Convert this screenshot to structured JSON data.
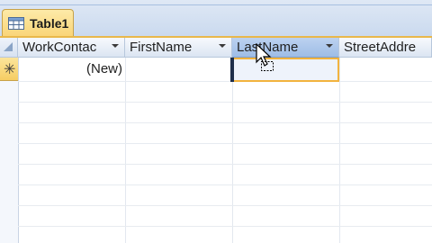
{
  "table_tab": {
    "label": "Table1",
    "icon": "table-icon"
  },
  "columns": [
    {
      "label": "WorkContac",
      "selected": false
    },
    {
      "label": "FirstName",
      "selected": false
    },
    {
      "label": "LastName",
      "selected": true
    },
    {
      "label": "StreetAddre",
      "selected": false
    }
  ],
  "new_row": {
    "marker": "✳",
    "first_cell": "(New)"
  },
  "colors": {
    "tab_fill": "#f9d476",
    "accent": "#f2b33e",
    "header_selected": "#9ebde6"
  }
}
